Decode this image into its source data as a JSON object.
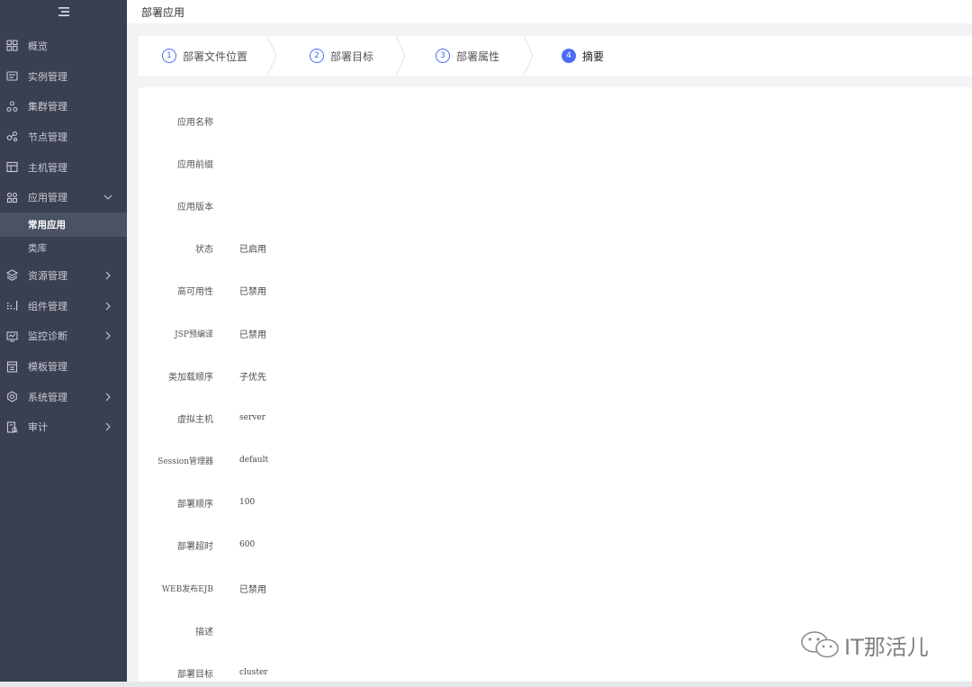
{
  "sidebar": {
    "menu": [
      {
        "label": "概览",
        "icon": "dashboard-icon",
        "chevron": false
      },
      {
        "label": "实例管理",
        "icon": "instance-icon",
        "chevron": false
      },
      {
        "label": "集群管理",
        "icon": "cluster-icon",
        "chevron": false
      },
      {
        "label": "节点管理",
        "icon": "node-icon",
        "chevron": false
      },
      {
        "label": "主机管理",
        "icon": "host-icon",
        "chevron": false
      },
      {
        "label": "应用管理",
        "icon": "app-icon",
        "chevron": "down"
      }
    ],
    "submenu": [
      {
        "label": "常用应用",
        "active": true
      },
      {
        "label": "类库",
        "active": false
      }
    ],
    "menu2": [
      {
        "label": "资源管理",
        "icon": "resource-icon",
        "chevron": "right"
      },
      {
        "label": "组件管理",
        "icon": "component-icon",
        "chevron": "right"
      },
      {
        "label": "监控诊断",
        "icon": "monitor-icon",
        "chevron": "right"
      },
      {
        "label": "模板管理",
        "icon": "template-icon",
        "chevron": false
      },
      {
        "label": "系统管理",
        "icon": "settings-icon",
        "chevron": "right"
      },
      {
        "label": "审计",
        "icon": "audit-icon",
        "chevron": "right"
      }
    ]
  },
  "header": {
    "title": "部署应用"
  },
  "steps": [
    {
      "num": "1",
      "label": "部署文件位置",
      "active": false
    },
    {
      "num": "2",
      "label": "部署目标",
      "active": false
    },
    {
      "num": "3",
      "label": "部署属性",
      "active": false
    },
    {
      "num": "4",
      "label": "摘要",
      "active": true
    }
  ],
  "summary": [
    {
      "label": "应用名称",
      "value": ""
    },
    {
      "label": "应用前缀",
      "value": ""
    },
    {
      "label": "应用版本",
      "value": ""
    },
    {
      "label": "状态",
      "value": "已启用"
    },
    {
      "label": "高可用性",
      "value": "已禁用"
    },
    {
      "label": "JSP预编译",
      "value": "已禁用"
    },
    {
      "label": "类加载顺序",
      "value": "子优先"
    },
    {
      "label": "虚拟主机",
      "value": "server"
    },
    {
      "label": "Session管理器",
      "value": "default"
    },
    {
      "label": "部署顺序",
      "value": "100"
    },
    {
      "label": "部署超时",
      "value": "600"
    },
    {
      "label": "WEB发布EJB",
      "value": "已禁用"
    },
    {
      "label": "描述",
      "value": ""
    },
    {
      "label": "部署目标",
      "value": "cluster"
    }
  ],
  "watermark": {
    "text": "IT那活儿",
    "icon": "wechat-icon"
  },
  "colors": {
    "sidebar_bg": "#3a3f51",
    "accent": "#4a6cf7",
    "active_sub_bg": "#4a5263"
  }
}
